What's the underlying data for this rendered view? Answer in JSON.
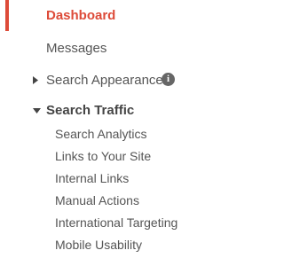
{
  "nav": {
    "dashboard": "Dashboard",
    "messages": "Messages",
    "search_appearance": "Search Appearance",
    "search_traffic": "Search Traffic",
    "info_icon_glyph": "i",
    "search_traffic_items": [
      "Search Analytics",
      "Links to Your Site",
      "Internal Links",
      "Manual Actions",
      "International Targeting",
      "Mobile Usability"
    ],
    "icons": {
      "search_appearance": "triangle-right-icon",
      "search_traffic": "triangle-down-icon",
      "info": "info-icon"
    },
    "colors": {
      "active": "#dd4b39",
      "text": "#555555",
      "icon": "#666666"
    }
  }
}
